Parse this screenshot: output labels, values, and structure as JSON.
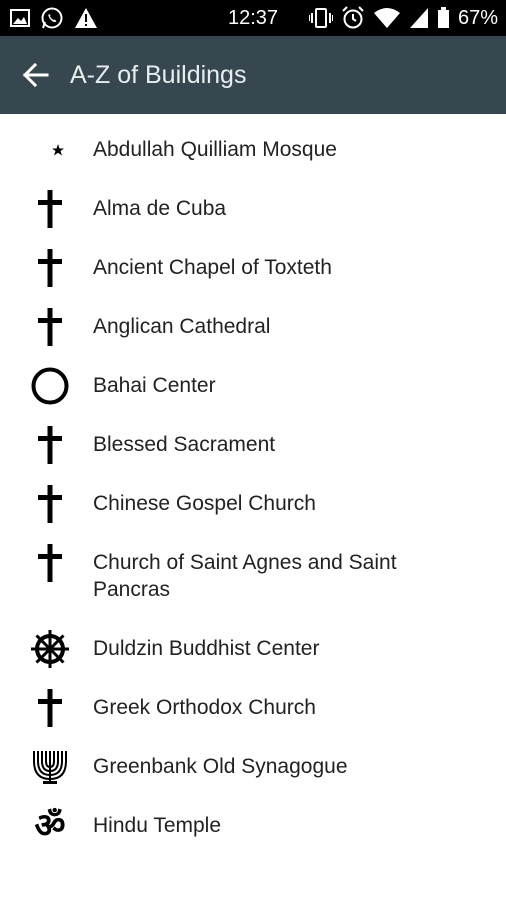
{
  "status_bar": {
    "time": "12:37",
    "battery_percent": "67%",
    "left_icons": [
      "image-icon",
      "whatsapp-icon",
      "warning-icon"
    ],
    "right_icons": [
      "vibrate-icon",
      "alarm-icon",
      "wifi-icon",
      "signal-icon",
      "battery-icon"
    ]
  },
  "toolbar": {
    "title": "A-Z of Buildings",
    "back_icon": "arrow-back-icon",
    "color": "#37474f"
  },
  "buildings": [
    {
      "name": "Abdullah Quilliam Mosque",
      "icon": "star-crescent-icon"
    },
    {
      "name": "Alma de Cuba",
      "icon": "cross-icon"
    },
    {
      "name": "Ancient Chapel of Toxteth",
      "icon": "cross-icon"
    },
    {
      "name": "Anglican Cathedral",
      "icon": "cross-icon"
    },
    {
      "name": "Bahai Center",
      "icon": "ring-icon"
    },
    {
      "name": "Blessed Sacrament",
      "icon": "cross-icon"
    },
    {
      "name": "Chinese Gospel Church",
      "icon": "cross-icon"
    },
    {
      "name": "Church of Saint Agnes and Saint Pancras",
      "icon": "cross-icon"
    },
    {
      "name": "Duldzin Buddhist Center",
      "icon": "dharma-wheel-icon"
    },
    {
      "name": "Greek Orthodox Church",
      "icon": "cross-icon"
    },
    {
      "name": "Greenbank Old Synagogue",
      "icon": "menorah-icon"
    },
    {
      "name": "Hindu Temple",
      "icon": "om-icon"
    }
  ]
}
